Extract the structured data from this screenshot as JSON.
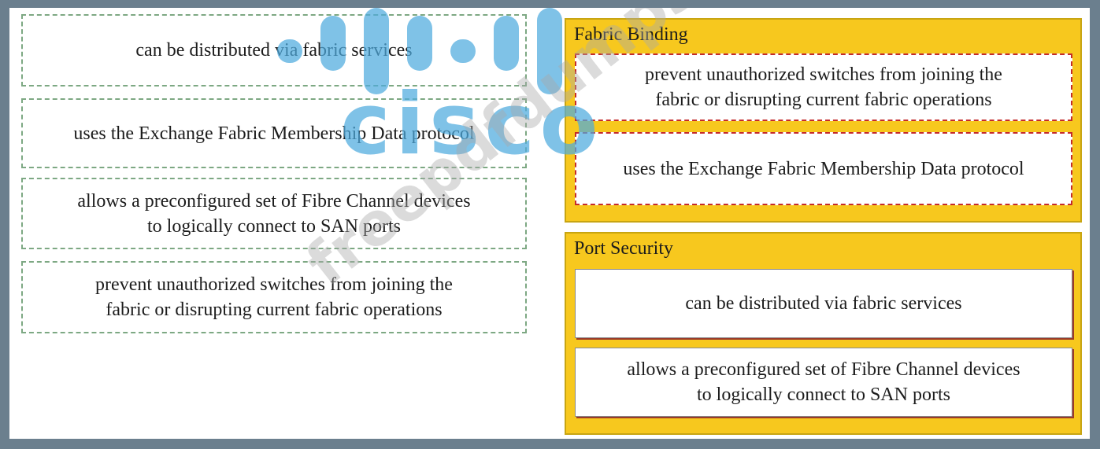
{
  "source_items": [
    "can be distributed via fabric services",
    "uses the Exchange Fabric Membership Data protocol",
    "allows a preconfigured set of Fibre Channel devices\nto logically connect to SAN ports",
    "prevent unauthorized switches from joining the\nfabric or disrupting current fabric operations"
  ],
  "targets": [
    {
      "title": "Fabric Binding",
      "slots": [
        "prevent unauthorized switches from joining the\nfabric or disrupting current fabric operations",
        "uses the Exchange Fabric Membership Data protocol"
      ]
    },
    {
      "title": "Port Security",
      "slots": [
        "can be distributed via fabric services",
        "allows a preconfigured set of Fibre Channel devices\nto logically connect to SAN ports"
      ]
    }
  ],
  "watermark": {
    "brand": "cisco",
    "site": "freepdfdumps.com"
  },
  "colors": {
    "panel": "#f7c81e",
    "source_border": "#7da883",
    "slot_border": "#c42b2b",
    "watermark_blue": "#4daade"
  }
}
